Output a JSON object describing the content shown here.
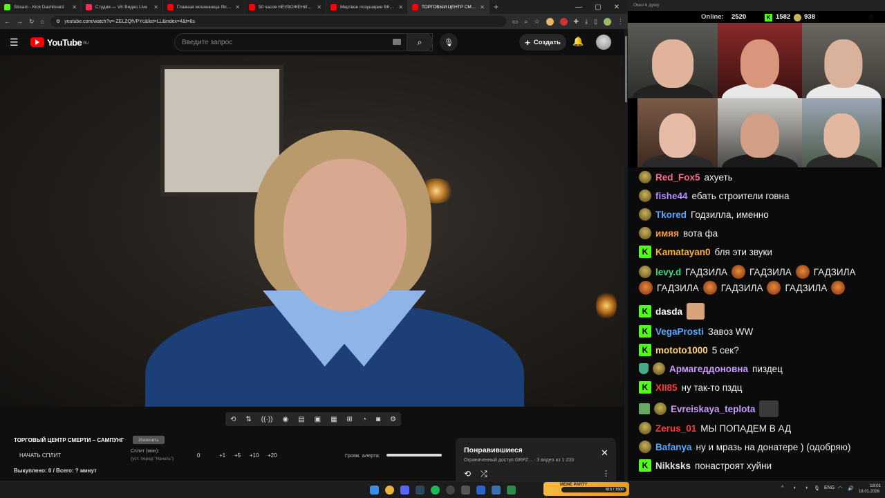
{
  "browser": {
    "tabs": [
      {
        "label": "Stream - Kick Dashboard",
        "favicon_color": "#53fc18",
        "active": false
      },
      {
        "label": "Студия — VK Видео Live",
        "favicon_color": "#ff2d55",
        "active": false
      },
      {
        "label": "Главная мошенница Японии",
        "favicon_color": "#ff0000",
        "active": false
      },
      {
        "label": "50 часов НЕУВОЖЕНИЯ в SAM",
        "favicon_color": "#ff0000",
        "active": false
      },
      {
        "label": "Мертвое поэушарие ВК КЛИП",
        "favicon_color": "#ff0000",
        "active": false
      },
      {
        "label": "ТОРГОВЫЙ ЦЕНТР СМЕРТИ",
        "favicon_color": "#ff0000",
        "active": true
      }
    ],
    "url": "youtube.com/watch?v=-ZELZQfVPYc&list=LL&index=4&t=8s"
  },
  "youtube": {
    "logo_text": "YouTube",
    "region": "RU",
    "search_placeholder": "Введите запрос",
    "create_label": "Создать"
  },
  "below_video": {
    "title": "ТОРГОВЫЙ ЦЕНТР СМЕРТИ – САМПУНГ",
    "edit_badge": "Изменить",
    "start_split": "НАЧАТЬ СПЛИТ",
    "split_label": "Сплит (мин):",
    "split_hint": "(уст. перед \"Начать\")",
    "split_value": "0",
    "increments": [
      "+1",
      "+5",
      "+10",
      "+20"
    ],
    "alert_volume_label": "Громк. алерта:",
    "bought_line": "Выкуплено: 0 / Всего: ? минут"
  },
  "playlist": {
    "title": "Понравившиеся",
    "subtitle": "Ограниченный доступ  GRPZ... · 3 видео из 1 233"
  },
  "stream_panel": {
    "window_title": "Окно в душу",
    "online_label": "Online:",
    "online_value": "2520",
    "kick_count": "1582",
    "other_count": "938"
  },
  "chat": [
    {
      "badge": "m",
      "user": "Red_Fox5",
      "color": "#ff6b8a",
      "text": "ахуеть"
    },
    {
      "badge": "m",
      "user": "fishe44",
      "color": "#b18cff",
      "text": "ебать строители говна"
    },
    {
      "badge": "m",
      "user": "Tkored",
      "color": "#5aa8ff",
      "text": "Годзилла, именно"
    },
    {
      "badge": "m",
      "user": "имяя",
      "color": "#ff9a3c",
      "text": "вота фа"
    },
    {
      "badge": "k",
      "user": "Kamatayan0",
      "color": "#ffb13c",
      "text": "бля эти звуки"
    },
    {
      "badge": "m",
      "user": "levy.d",
      "color": "#3ddc84",
      "text": "ГАДЗИЛА",
      "line2": "ГАДЗИЛА"
    },
    {
      "badge": "k",
      "user": "dasda",
      "color": "#ffffff",
      "text": ""
    },
    {
      "badge": "k",
      "user": "VegaProsti",
      "color": "#5aa8ff",
      "text": "Завоз WW"
    },
    {
      "badge": "k",
      "user": "mototo1000",
      "color": "#ffd27a",
      "text": "5 сек?"
    },
    {
      "badge": "s",
      "user": "Армагеддоновна",
      "color": "#c99cff",
      "text": "пиздец"
    },
    {
      "badge": "k",
      "user": "XII85",
      "color": "#ff3b3b",
      "text": "ну так-то пздц"
    },
    {
      "badge": "w",
      "user": "Evreiskaya_teplota",
      "color": "#c99cff",
      "text": ""
    },
    {
      "badge": "m",
      "user": "Zerus_01",
      "color": "#ff3b3b",
      "text": "МЫ ПОПАДЕМ В АД"
    },
    {
      "badge": "m",
      "user": "Bafanya",
      "color": "#5aa8ff",
      "text": "ну и мразь на донатере ) (одобряю)"
    },
    {
      "badge": "k",
      "user": "Nikksks",
      "color": "#dddddd",
      "text": "понастроят хуйни"
    }
  ],
  "taskbar": {
    "meme_label": "MEME PARTY",
    "meme_progress": "815 / 1500",
    "language": "ENG",
    "time": "18:01",
    "date": "18.01.2026"
  }
}
